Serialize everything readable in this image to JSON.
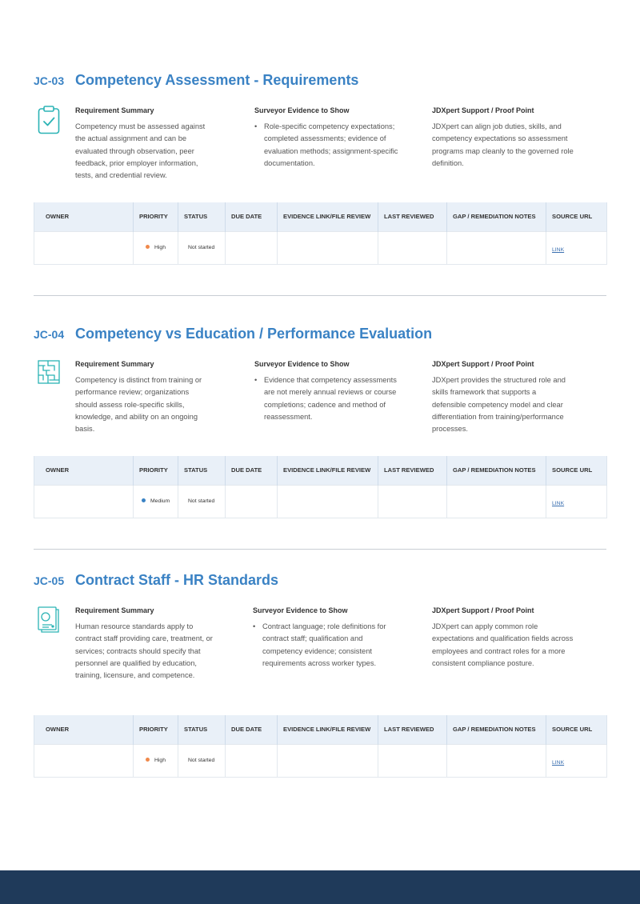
{
  "table_headers": [
    "OWNER",
    "PRIORITY",
    "STATUS",
    "DUE DATE",
    "EVIDENCE LINK/FILE REVIEW",
    "LAST REVIEWED",
    "GAP /  REMEDIATION NOTES",
    "SOURCE URL"
  ],
  "colors": {
    "accent": "#3a82c4",
    "icon_teal": "#2bb3b5",
    "header_bg": "#e9f0f8",
    "footer": "#1f3a5a",
    "priority_high": "#f0894b",
    "priority_medium": "#3a82c4"
  },
  "sections": [
    {
      "code": "JC-03",
      "title": "Competency Assessment - Requirements",
      "icon": "clipboard-check-icon",
      "summary_title": "Requirement Summary",
      "summary_text": "Competency must be assessed against the actual assignment and can be evaluated through observation, peer feedback, prior employer information, tests, and credential review.",
      "evidence_title": "Surveyor Evidence to Show",
      "evidence_items": [
        "Role-specific competency expectations; completed assessments; evidence of evaluation methods; assignment-specific documentation."
      ],
      "support_title": "JDXpert Support / Proof Point",
      "support_text": "JDXpert can align job duties, skills, and competency expectations so assessment programs map cleanly to the governed role definition.",
      "row": {
        "owner": "",
        "priority": "High",
        "status": "Not started",
        "due_date": "",
        "evidence": "",
        "last_reviewed": "",
        "gap_notes": "",
        "source": "LINK"
      }
    },
    {
      "code": "JC-04",
      "title": "Competency vs Education / Performance Evaluation",
      "icon": "maze-icon",
      "summary_title": "Requirement Summary",
      "summary_text": "Competency is distinct from training or performance review; organizations should assess role-specific skills, knowledge, and ability on an ongoing basis.",
      "evidence_title": "Surveyor Evidence to Show",
      "evidence_items": [
        "Evidence that competency assessments are not merely annual reviews or course completions; cadence and method of reassessment."
      ],
      "support_title": "JDXpert Support / Proof Point",
      "support_text": "JDXpert provides the structured role and skills framework that supports a defensible competency model and clear differentiation from training/performance processes.",
      "row": {
        "owner": "",
        "priority": "Medium",
        "status": "Not started",
        "due_date": "",
        "evidence": "",
        "last_reviewed": "",
        "gap_notes": "",
        "source": "LINK"
      }
    },
    {
      "code": "JC-05",
      "title": "Contract Staff - HR Standards",
      "icon": "documents-icon",
      "summary_title": "Requirement Summary",
      "summary_text": "Human resource standards apply to contract staff providing care, treatment, or services; contracts should specify that personnel are qualified by education, training, licensure, and competence.",
      "evidence_title": "Surveyor Evidence to Show",
      "evidence_items": [
        "Contract language; role definitions for contract staff; qualification and competency evidence; consistent requirements across worker types."
      ],
      "support_title": "JDXpert Support / Proof Point",
      "support_text": "JDXpert can apply common role expectations and qualification fields across employees and contract roles for a more consistent compliance posture.",
      "row": {
        "owner": "",
        "priority": "High",
        "status": "Not started",
        "due_date": "",
        "evidence": "",
        "last_reviewed": "",
        "gap_notes": "",
        "source": "LINK"
      }
    }
  ]
}
